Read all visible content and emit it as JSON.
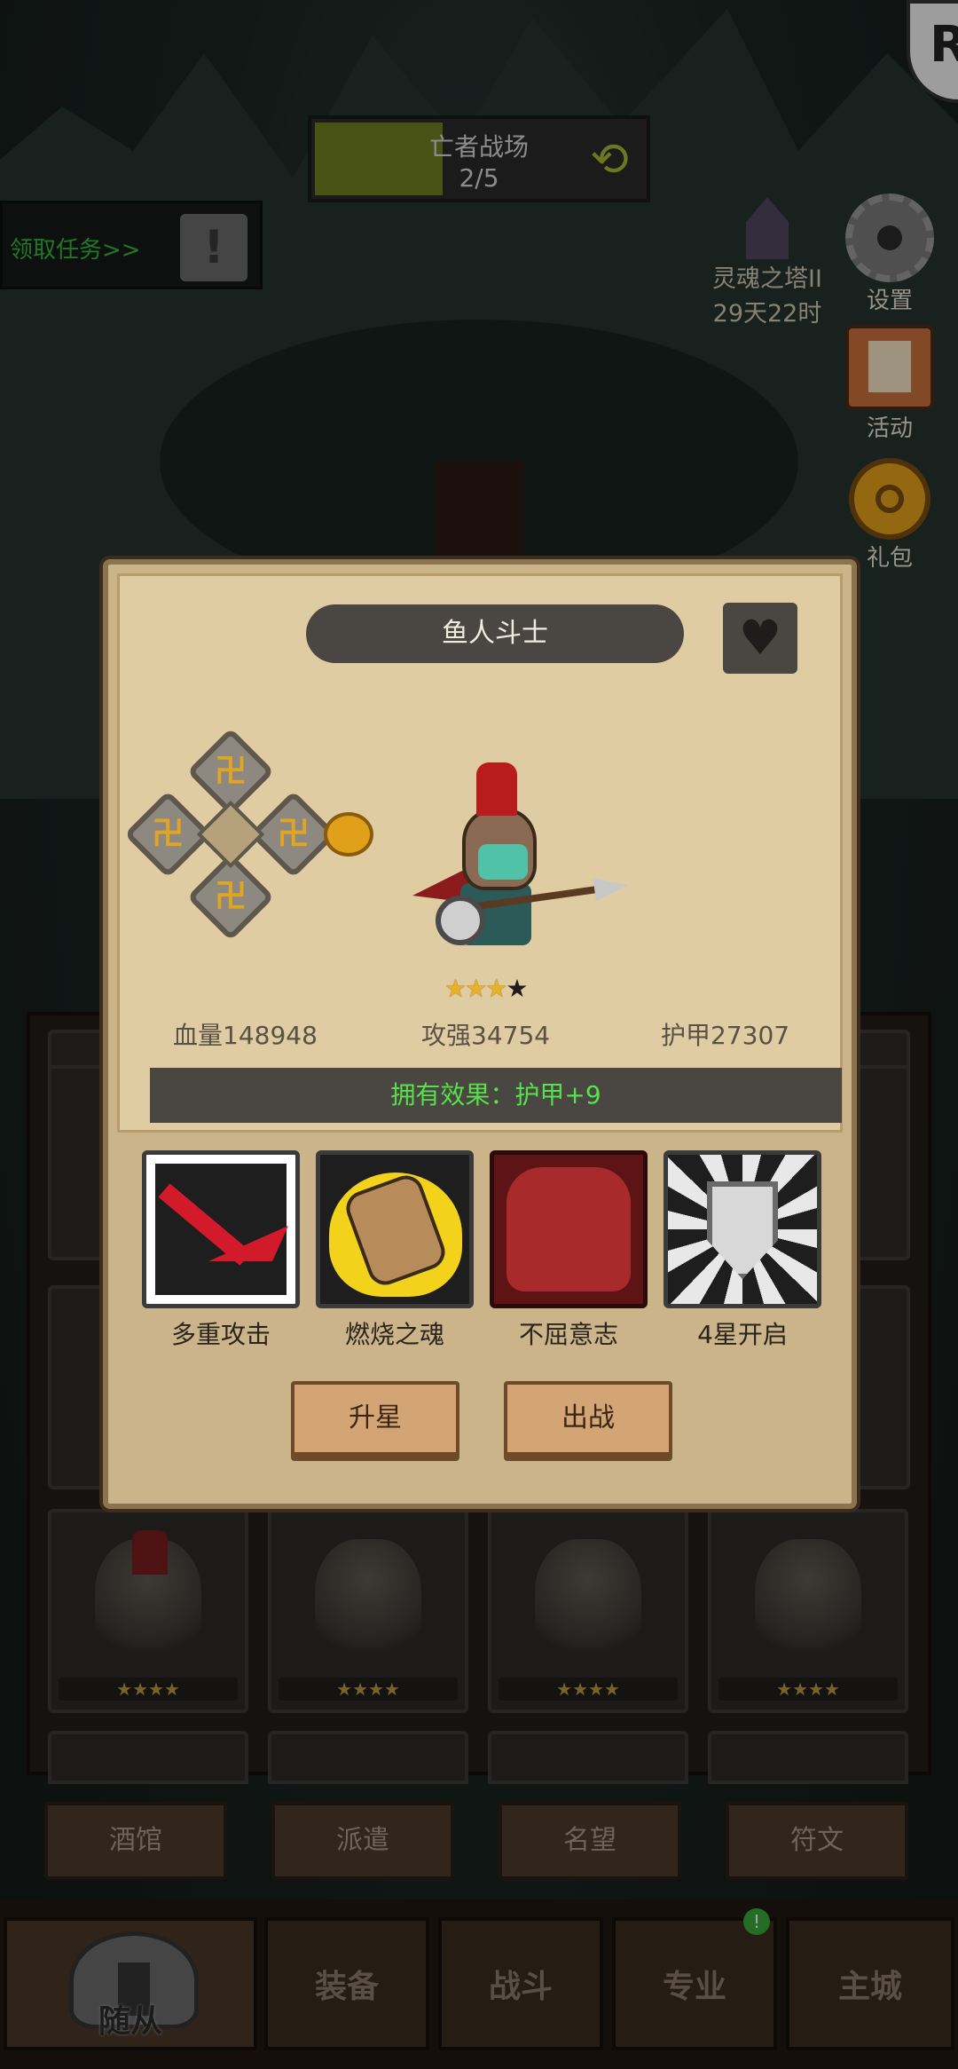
{
  "stage": {
    "title": "亡者战场",
    "progress": "2/5",
    "fill_ratio": 0.38
  },
  "quest": {
    "text": "领取任务>>"
  },
  "corner_badge": {
    "letter": "R"
  },
  "tower": {
    "name": "灵魂之塔II",
    "time": "29天22时"
  },
  "side_buttons": {
    "settings": "设置",
    "activity": "活动",
    "gift": "礼包"
  },
  "modal": {
    "title": "鱼人斗士",
    "stars": {
      "filled": 3,
      "total": 4
    },
    "stats": {
      "hp": "血量148948",
      "attack": "攻强34754",
      "armor": "护甲27307"
    },
    "effect": "拥有效果：护甲+9",
    "skills": [
      {
        "label": "多重攻击"
      },
      {
        "label": "燃烧之魂"
      },
      {
        "label": "不屈意志"
      },
      {
        "label": "4星开启"
      }
    ],
    "buttons": {
      "upgrade": "升星",
      "deploy": "出战"
    },
    "rune_glyph": "卍"
  },
  "grid_cards": [
    {
      "stars": "★★★★"
    },
    {
      "stars": "★★★★"
    },
    {
      "stars": "★★★★"
    },
    {
      "stars": "★★★★"
    }
  ],
  "bottom_nav": {
    "row": [
      "酒馆",
      "派遣",
      "名望",
      "符文"
    ],
    "tabs": {
      "followers": "随从",
      "equipment": "装备",
      "battle": "战斗",
      "profession": "专业",
      "city": "主城"
    },
    "badge": "!"
  },
  "colors": {
    "effect_green": "#55e24b",
    "star_gold": "#e6b227",
    "quest_green": "#2fb93a"
  }
}
